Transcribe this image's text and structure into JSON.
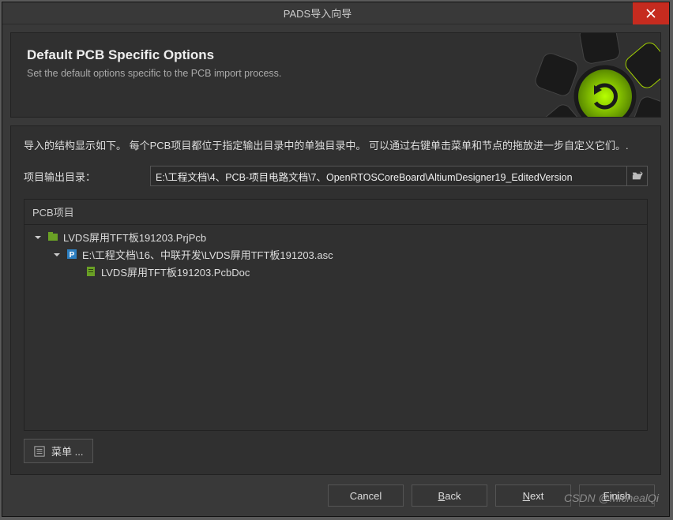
{
  "window": {
    "title": "PADS导入向导"
  },
  "header": {
    "title": "Default PCB Specific Options",
    "subtitle": "Set the default options specific to the PCB import process."
  },
  "body": {
    "description": "导入的结构显示如下。 每个PCB项目都位于指定输出目录中的单独目录中。 可以通过右键单击菜单和节点的拖放进一步自定义它们。.",
    "output_label": "项目输出目录：",
    "output_path": "E:\\工程文档\\4、PCB-项目电路文档\\7、OpenRTOSCoreBoard\\AltiumDesigner19_EditedVersion"
  },
  "tree": {
    "header": "PCB项目",
    "items": [
      {
        "indent": 1,
        "expander": "down",
        "icon": "project-green",
        "label": "LVDS屏用TFT板191203.PrjPcb"
      },
      {
        "indent": 2,
        "expander": "down",
        "icon": "file-p",
        "label": "E:\\工程文档\\16、中联开发\\LVDS屏用TFT板191203.asc"
      },
      {
        "indent": 3,
        "expander": "none",
        "icon": "file-green",
        "label": "LVDS屏用TFT板191203.PcbDoc"
      }
    ]
  },
  "menu_button": "菜单 ...",
  "footer": {
    "cancel": "Cancel",
    "back_u": "B",
    "back_rest": "ack",
    "next_u": "N",
    "next_rest": "ext",
    "finish_u": "F",
    "finish_rest": "inish"
  },
  "watermark": "CSDN @MichealQi"
}
